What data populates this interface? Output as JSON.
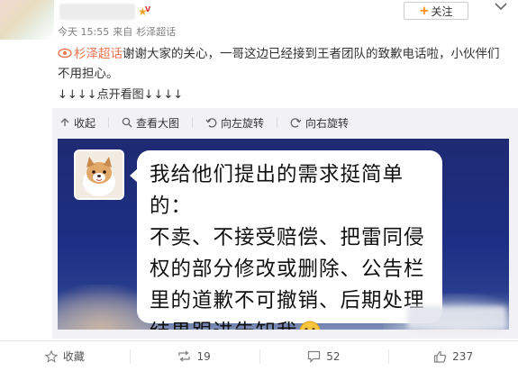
{
  "header": {
    "follow_label": "关注",
    "follow_plus": "+",
    "timestamp": "今天 15:55",
    "source_prefix": "来自",
    "source": "杉泽超话"
  },
  "post": {
    "topic": "杉泽超话",
    "text": "谢谢大家的关心，一哥这边已经接到王者团队的致歉电话啦，小伙伴们不用担心。",
    "arrows": "↓↓↓↓点开看图↓↓↓↓"
  },
  "media_toolbar": {
    "collapse": "收起",
    "view_large": "查看大图",
    "rotate_left": "向左旋转",
    "rotate_right": "向右旋转"
  },
  "image": {
    "bubble_lines": [
      "我给他们提出的需求挺简单的：",
      "不卖、不接受赔偿、把雷同侵",
      "权的部分修改或删除、公告栏",
      "里的道歉不可撤销、后期处理",
      "结果跟进告知我"
    ]
  },
  "footer": {
    "favorite": "收藏",
    "reposts": "19",
    "comments": "52",
    "likes": "237"
  },
  "colors": {
    "topic": "#eb7350",
    "follow_plus": "#ff8200",
    "image_bg": "#1d2f84"
  }
}
